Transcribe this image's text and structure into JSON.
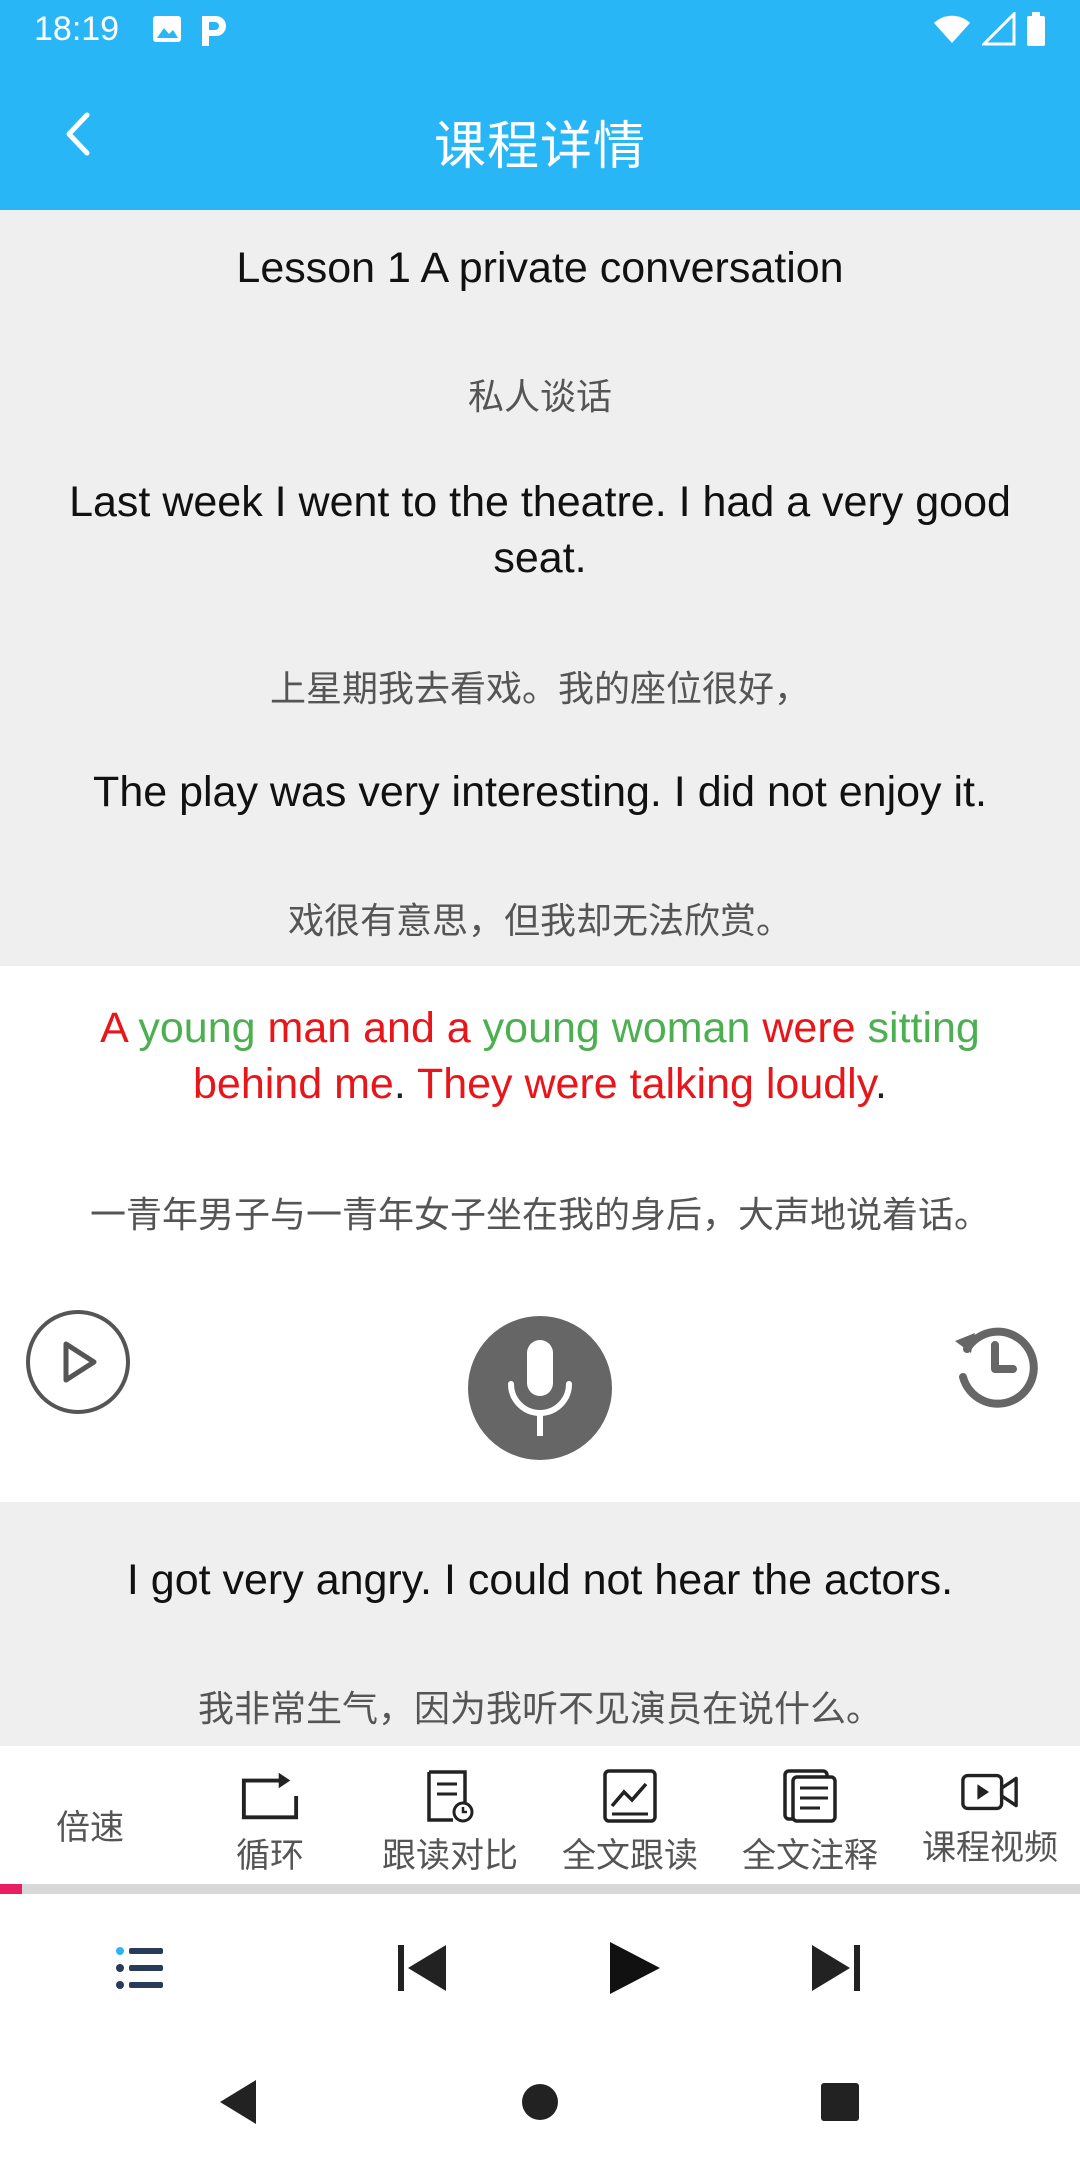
{
  "status": {
    "time": "18:19"
  },
  "header": {
    "title": "课程详情"
  },
  "lesson": {
    "title": "Lesson 1 A private conversation",
    "title_trans": "私人谈话",
    "s1_line1": "Last week I went to the theatre. I had a very good",
    "s1_line2": "seat.",
    "s1_trans": "上星期我去看戏。我的座位很好，",
    "s2": "The play was very interesting. I did not enjoy it.",
    "s2_trans": "戏很有意思，但我却无法欣赏。",
    "s3_words": {
      "w1": "A",
      "w2": "young",
      "w3": "man and a",
      "w4": "young woman",
      "w5": "were",
      "w6": "sitting",
      "w7": "behind me",
      "w8": ".",
      "w9": "They were talking loudly",
      "w10": "."
    },
    "s3_trans": "一青年男子与一青年女子坐在我的身后，大声地说着话。",
    "s4": "I got very angry. I could not hear the actors.",
    "s4_trans": "我非常生气，因为我听不见演员在说什么。"
  },
  "colors": {
    "accent": "#29b6f6",
    "highlight_red": "#e8161a",
    "highlight_green": "#4caf50",
    "progress": "#e91e63"
  },
  "toolbar": {
    "speed": "倍速",
    "loop": "循环",
    "compare": "跟读对比",
    "full_read": "全文跟读",
    "annotate": "全文注释",
    "video": "课程视频"
  },
  "progress": {
    "fraction": 0.02
  },
  "icons": [
    "back-icon",
    "play-icon",
    "mic-icon",
    "history-icon",
    "list-icon",
    "prev-icon",
    "next-icon"
  ]
}
